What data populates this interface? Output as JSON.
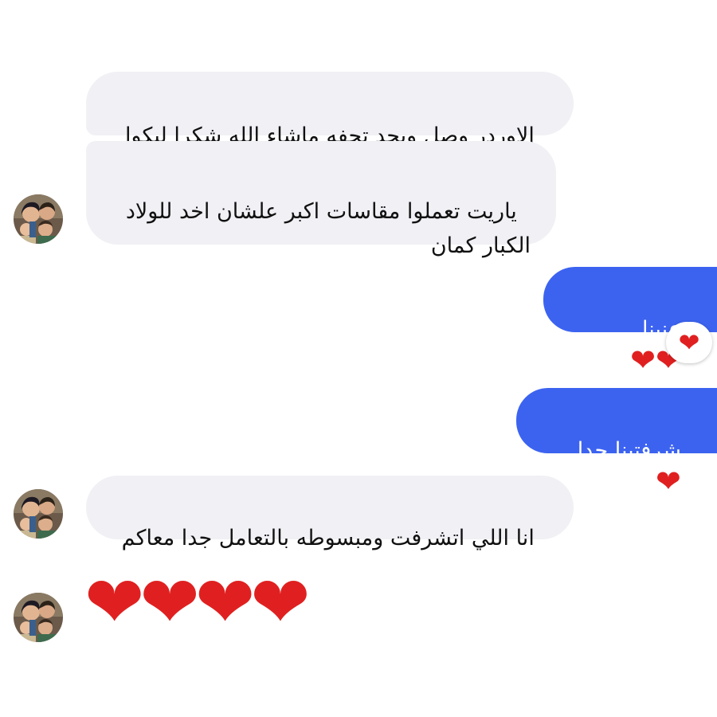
{
  "conversation": {
    "messages": [
      {
        "sender": "contact",
        "text": "الاوردر وصل وبجد تحفه ماشاء الله شكرا ليكوا"
      },
      {
        "sender": "contact",
        "text": "ياريت تعملوا مقاسات اكبر علشان اخد للولاد\nالكبار كمان"
      },
      {
        "sender": "me",
        "text": "عنينا",
        "emoji": "❤❤"
      },
      {
        "sender": "me",
        "text": "شرفتينا جدا",
        "emoji": "❤"
      },
      {
        "sender": "contact",
        "text": "انا اللي اتشرفت ومبسوطه بالتعامل جدا معاكم"
      },
      {
        "sender": "contact",
        "emoji": "❤❤❤❤"
      }
    ],
    "reaction": {
      "emoji": "❤"
    }
  },
  "colors": {
    "outgoing_bubble": "#3c63f0",
    "incoming_bubble": "#f0f0f5",
    "heart": "#e02020"
  },
  "icons": {
    "avatar": "cartoon-family-avatar",
    "heart": "red-heart-emoji"
  }
}
